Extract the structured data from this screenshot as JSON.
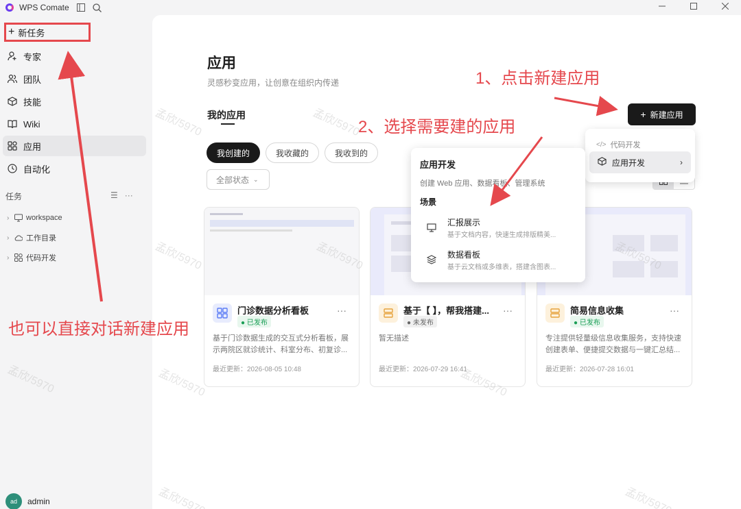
{
  "window": {
    "title": "WPS Comate",
    "controls": [
      "minimize",
      "maximize",
      "close"
    ]
  },
  "sidebar": {
    "new_task": "新任务",
    "nav": [
      {
        "label": "专家",
        "icon": "person-add-icon"
      },
      {
        "label": "团队",
        "icon": "team-icon"
      },
      {
        "label": "技能",
        "icon": "cube-icon"
      },
      {
        "label": "Wiki",
        "icon": "book-icon"
      },
      {
        "label": "应用",
        "icon": "apps-icon",
        "active": true
      },
      {
        "label": "自动化",
        "icon": "clock-icon"
      }
    ],
    "tasks_label": "任务",
    "task_tree": [
      {
        "label": "workspace",
        "icon": "monitor-icon"
      },
      {
        "label": "工作目录",
        "icon": "cloud-icon"
      },
      {
        "label": "代码开发",
        "icon": "apps-icon"
      }
    ],
    "user": {
      "avatar": "ad",
      "name": "admin"
    }
  },
  "main": {
    "title": "应用",
    "subtitle": "灵感秒变应用，让创意在组织内传递",
    "section_title": "我的应用",
    "new_app_button": "新建应用",
    "filter_tabs": [
      "我创建的",
      "我收藏的",
      "我收到的"
    ],
    "status_filter": "全部状态",
    "cards": [
      {
        "title": "门诊数据分析看板",
        "status": "已发布",
        "description": "基于门诊数据生成的交互式分析看板，展示两院区就诊统计、科室分布、初复诊...",
        "updated": "最近更新：2026-08-05 10:48"
      },
      {
        "title": "基于【 】，帮我搭建...",
        "status": "未发布",
        "description": "暂无描述",
        "updated": "最近更新：2026-07-29 16:41"
      },
      {
        "title": "简易信息收集",
        "status": "已发布",
        "description": "专注提供轻量级信息收集服务，支持快速创建表单、便捷提交数据与一键汇总结...",
        "updated": "最近更新：2026-07-28 16:01"
      }
    ]
  },
  "new_app_menu": {
    "category": "代码开发",
    "item": "应用开发"
  },
  "app_dev_menu": {
    "title": "应用开发",
    "description": "创建 Web 应用、数据看板、管理系统",
    "scene_label": "场景",
    "items": [
      {
        "name": "汇报展示",
        "description": "基于文档内容，快速生成排版精美..."
      },
      {
        "name": "数据看板",
        "description": "基于云文档或多维表，搭建含图表..."
      }
    ]
  },
  "annotations": {
    "step1": "1、点击新建应用",
    "step2": "2、选择需要建的应用",
    "alt": "也可以直接对话新建应用"
  },
  "watermark": "孟欣/5970",
  "colors": {
    "annotation": "#e5484d",
    "published": "#1a9e55",
    "primary_button": "#1a1a1a"
  }
}
